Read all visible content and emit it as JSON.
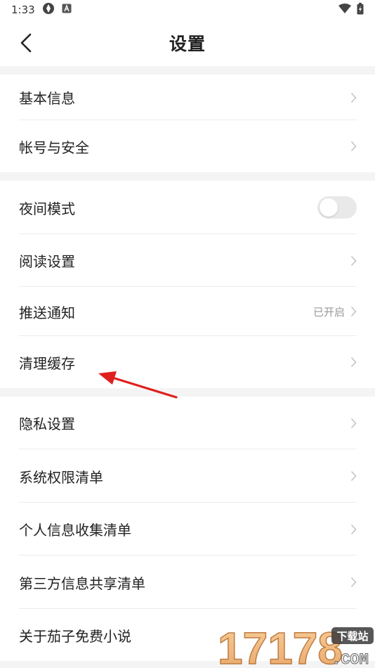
{
  "status_bar": {
    "time": "1:33"
  },
  "nav": {
    "title": "设置"
  },
  "sections": [
    {
      "items": [
        {
          "label": "基本信息",
          "type": "chevron"
        },
        {
          "label": "帐号与安全",
          "type": "chevron"
        }
      ]
    },
    {
      "items": [
        {
          "label": "夜间模式",
          "type": "toggle",
          "toggle_on": false
        },
        {
          "label": "阅读设置",
          "type": "chevron"
        },
        {
          "label": "推送通知",
          "type": "chevron",
          "status": "已开启"
        },
        {
          "label": "清理缓存",
          "type": "chevron"
        }
      ]
    },
    {
      "items": [
        {
          "label": "隐私设置",
          "type": "chevron"
        },
        {
          "label": "系统权限清单",
          "type": "chevron"
        },
        {
          "label": "个人信息收集清单",
          "type": "chevron"
        },
        {
          "label": "第三方信息共享清单",
          "type": "chevron"
        },
        {
          "label": "关于茄子免费小说",
          "type": "chevron"
        }
      ]
    }
  ],
  "watermark": {
    "number": "17178",
    "tag": "下载站",
    "suffix": ".COM"
  },
  "colors": {
    "background": "#ffffff",
    "section_gap": "#f4f4f4",
    "annotation_arrow": "#e0201c"
  }
}
